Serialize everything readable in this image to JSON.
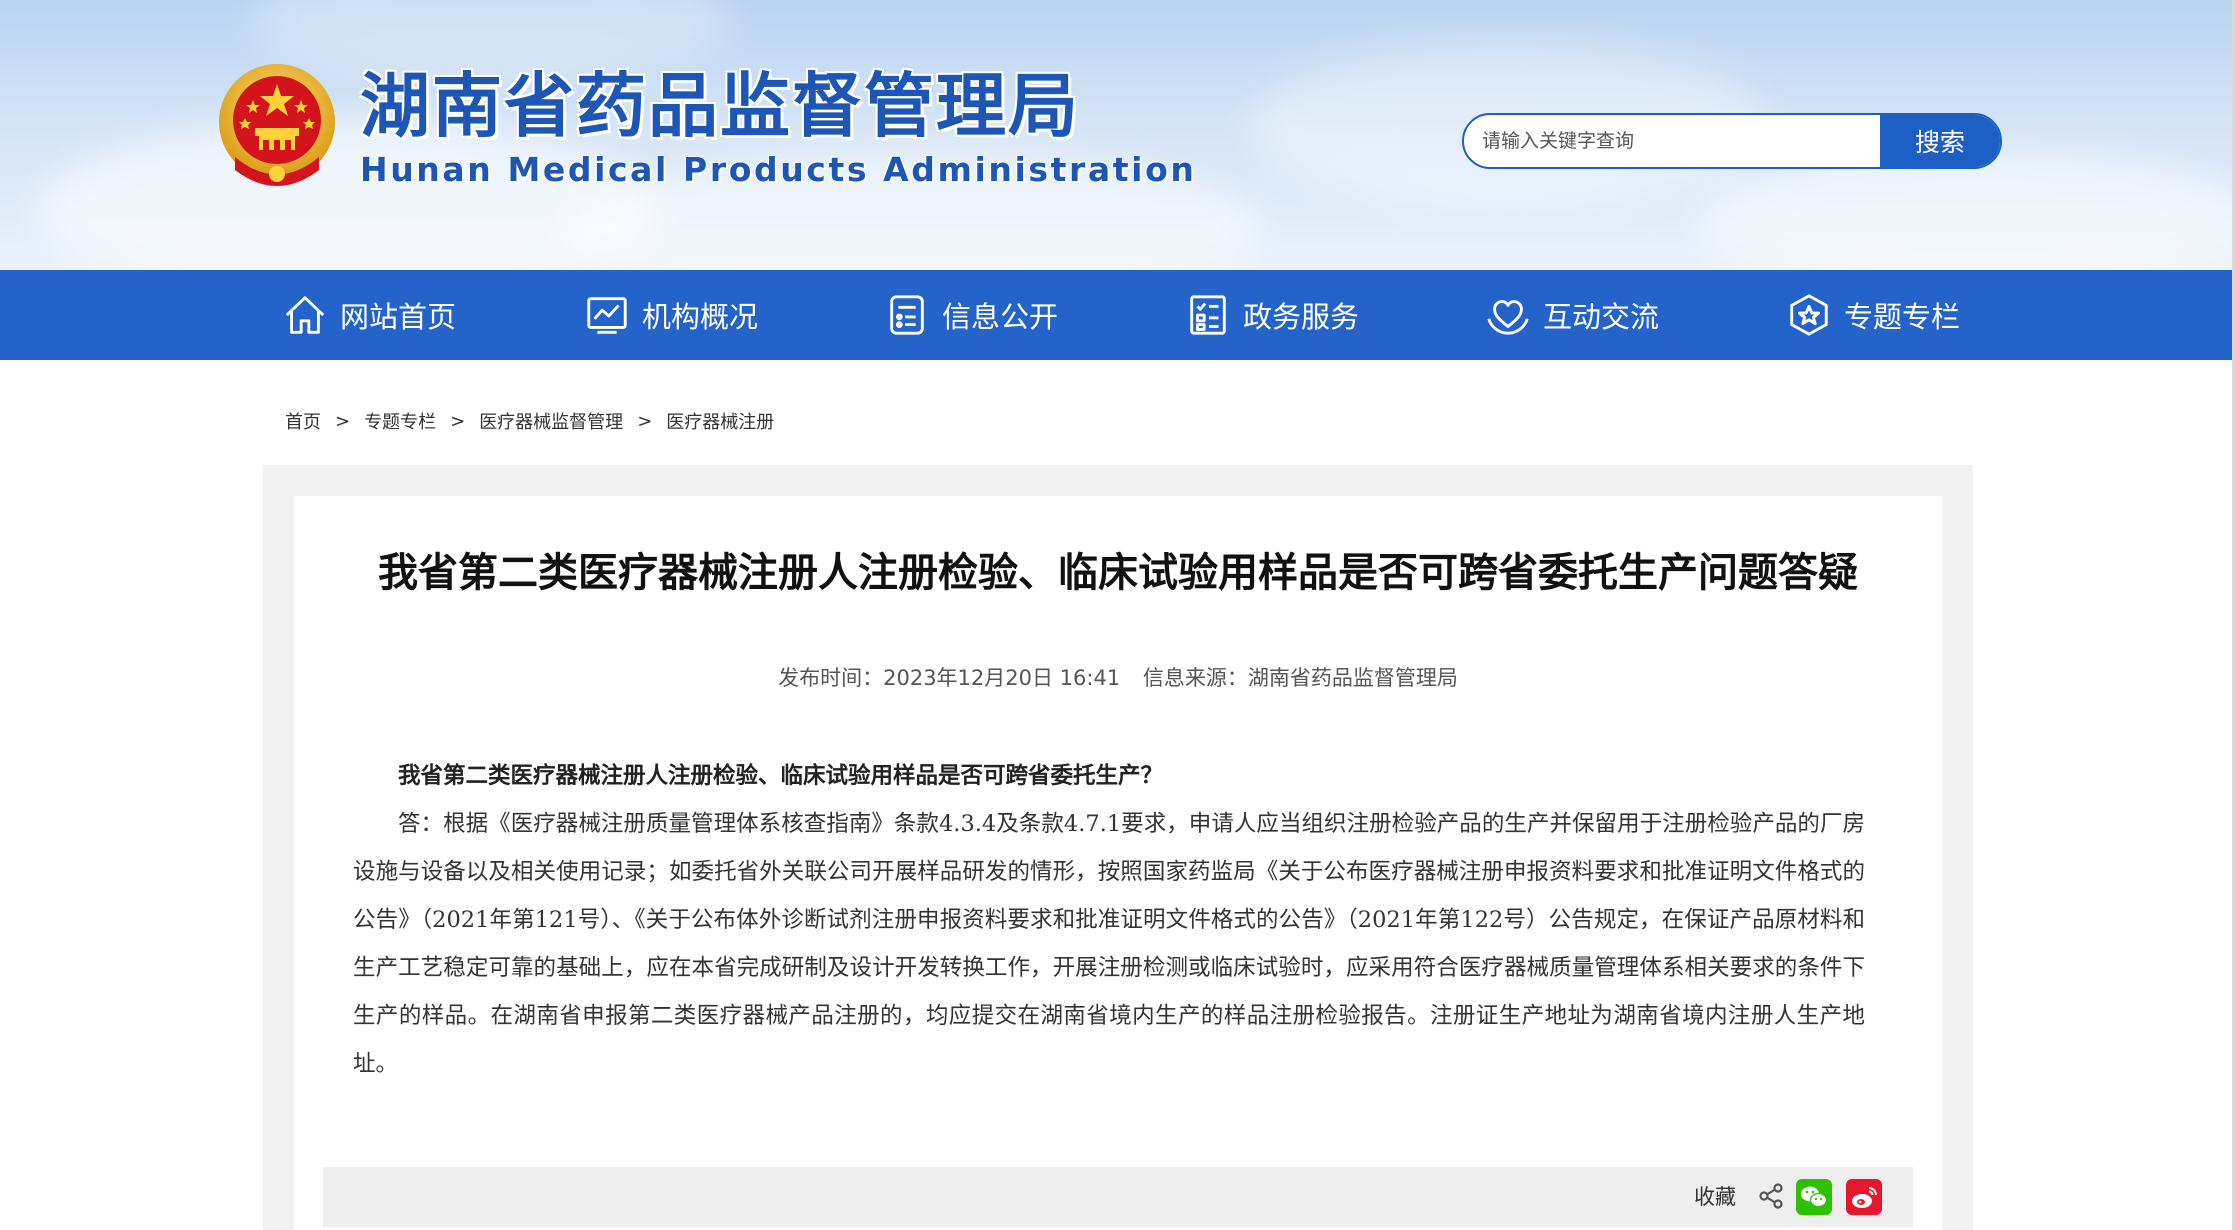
{
  "header": {
    "site_title": "湖南省药品监督管理局",
    "site_subtitle": "Hunan Medical Products Administration"
  },
  "search": {
    "placeholder": "请输入关键字查询",
    "button_label": "搜索"
  },
  "nav": {
    "items": [
      {
        "label": "网站首页",
        "icon": "home-icon"
      },
      {
        "label": "机构概况",
        "icon": "chart-monitor-icon"
      },
      {
        "label": "信息公开",
        "icon": "document-list-icon"
      },
      {
        "label": "政务服务",
        "icon": "checklist-icon"
      },
      {
        "label": "互动交流",
        "icon": "heart-hands-icon"
      },
      {
        "label": "专题专栏",
        "icon": "star-badge-icon"
      }
    ]
  },
  "breadcrumb": {
    "items": [
      "首页",
      "专题专栏",
      "医疗器械监督管理",
      "医疗器械注册"
    ],
    "separator": ">"
  },
  "article": {
    "title": "我省第二类医疗器械注册人注册检验、临床试验用样品是否可跨省委托生产问题答疑",
    "publish_time": "发布时间：2023年12月20日 16:41",
    "source": "信息来源：湖南省药品监督管理局",
    "question": "我省第二类医疗器械注册人注册检验、临床试验用样品是否可跨省委托生产？",
    "answer": "答：根据《医疗器械注册质量管理体系核查指南》条款4.3.4及条款4.7.1要求，申请人应当组织注册检验产品的生产并保留用于注册检验产品的厂房设施与设备以及相关使用记录；如委托省外关联公司开展样品研发的情形，按照国家药监局《关于公布医疗器械注册申报资料要求和批准证明文件格式的公告》（2021年第121号）、《关于公布体外诊断试剂注册申报资料要求和批准证明文件格式的公告》（2021年第122号）公告规定，在保证产品原材料和生产工艺稳定可靠的基础上，应在本省完成研制及设计开发转换工作，开展注册检测或临床试验时，应采用符合医疗器械质量管理体系相关要求的条件下生产的样品。在湖南省申报第二类医疗器械产品注册的，均应提交在湖南省境内生产的样品注册检验报告。注册证生产地址为湖南省境内注册人生产地址。"
  },
  "share": {
    "collect_label": "收藏"
  },
  "colors": {
    "nav_blue": "#2463c9",
    "title_blue": "#1d56b5",
    "wechat_green": "#2dc100",
    "weibo_red": "#e6162d"
  }
}
